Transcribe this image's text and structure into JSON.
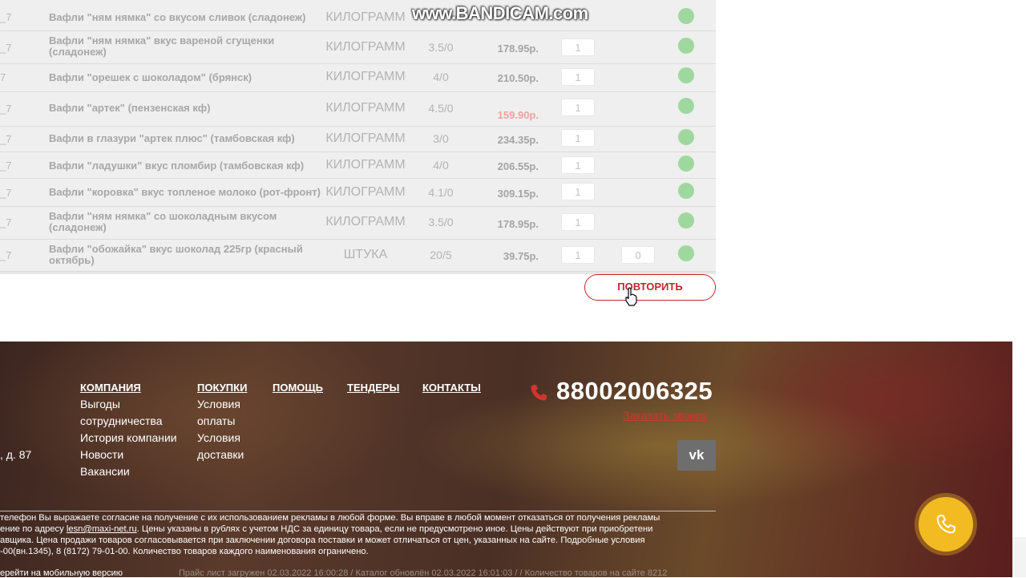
{
  "watermark": "www.BANDICAM.com",
  "products": [
    {
      "code": "_7",
      "name": "Вафли \"ням нямка\" со вкусом сливок (сладонеж)",
      "unit": "КИЛОГРАММ",
      "pack": "",
      "price": "",
      "qty": "",
      "extra": ""
    },
    {
      "code": "_7",
      "name": "Вафли \"ням нямка\" вкус вареной сгущенки (сладонеж)",
      "unit": "КИЛОГРАММ",
      "pack": "3.5/0",
      "price": "178.95р.",
      "qty": "1",
      "extra": ""
    },
    {
      "code": "7",
      "name": "Вафли \"орешек с шоколадом\" (брянск)",
      "unit": "КИЛОГРАММ",
      "pack": "4/0",
      "price": "210.50р.",
      "qty": "1",
      "extra": ""
    },
    {
      "code": "_7",
      "name": "Вафли \"артек\" (пензенская кф)",
      "unit": "КИЛОГРАММ",
      "pack": "4.5/0",
      "price": "159.90р.",
      "qty": "1",
      "extra": "",
      "sale": true
    },
    {
      "code": "_7",
      "name": "Вафли в глазури \"артек плюс\" (тамбовская кф)",
      "unit": "КИЛОГРАММ",
      "pack": "3/0",
      "price": "234.35р.",
      "qty": "1",
      "extra": ""
    },
    {
      "code": "_7",
      "name": "Вафли \"ладушки\" вкус пломбир (тамбовская кф)",
      "unit": "КИЛОГРАММ",
      "pack": "4/0",
      "price": "206.55р.",
      "qty": "1",
      "extra": ""
    },
    {
      "code": "_7",
      "name": "Вафли \"коровка\" вкус топленое молоко (рот-фронт)",
      "unit": "КИЛОГРАММ",
      "pack": "4.1/0",
      "price": "309.15р.",
      "qty": "1",
      "extra": ""
    },
    {
      "code": "_7",
      "name": "Вафли \"ням нямка\" со шоколадным вкусом (сладонеж)",
      "unit": "КИЛОГРАММ",
      "pack": "3.5/0",
      "price": "178.95р.",
      "qty": "1",
      "extra": ""
    },
    {
      "code": "_7",
      "name": "Вафли \"обожайка\" вкус шоколад 225гр (красный октябрь)",
      "unit": "ШТУКА",
      "pack": "20/5",
      "price": "39.75р.",
      "qty": "1",
      "extra": "0"
    }
  ],
  "repeat_button": "ПОВТОРИТЬ",
  "footer": {
    "company": {
      "head": "КОМПАНИЯ",
      "links": [
        "Выгоды",
        "сотрудничества",
        "История компании",
        "Новости",
        "Вакансии"
      ]
    },
    "purchases": {
      "head": "ПОКУПКИ",
      "links": [
        "Условия",
        "оплаты",
        "Условия",
        "доставки"
      ]
    },
    "help": "ПОМОЩЬ",
    "tenders": "ТЕНДЕРЫ",
    "contacts": "КОНТАКТЫ",
    "address": ", д. 87",
    "phone": "88002006325",
    "callback": "Заказать звонок",
    "vk": "vk",
    "legal": [
      "телефон Вы выражаете согласие на получение с их использованием рекламы в любой форме. Вы вправе в любой момент отказаться от получения рекламы",
      "ение по адресу ",
      "lesn@maxi-net.ru",
      ". Цены указаны в рублях с учетом НДС за единицу товара, если не предусмотрено иное. Цены действуют при приобретени",
      "авщика. Цена продажи товаров согласовывается при заключении договора поставки и может отличаться от цен, указанных на сайте. Подробные условия",
      "-00(вн.1345), 8 (8172) 79-01-00. Количество товаров каждого наименования ограничено."
    ],
    "mobile": "ерейти на мобильную версию",
    "info": "Прайс лист загружен 02.03.2022 16:00:28 / Каталог обновлён 02.03.2022 16:01:03 / / Количество товаров на сайте 8212"
  }
}
